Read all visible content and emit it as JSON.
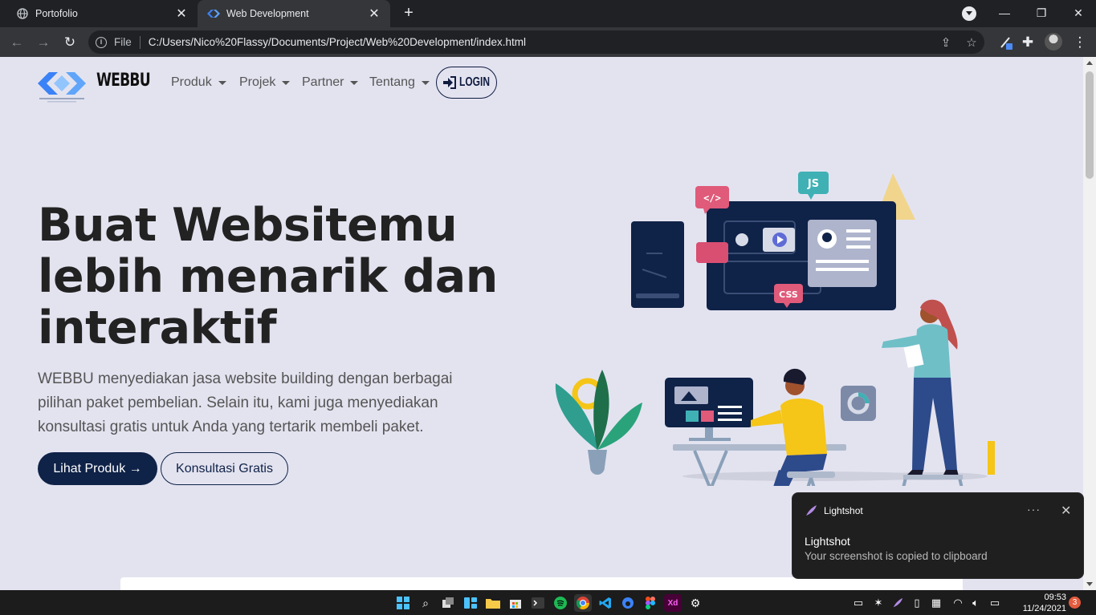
{
  "browser": {
    "tabs": [
      {
        "title": "Portofolio",
        "active": false
      },
      {
        "title": "Web Development",
        "active": true
      }
    ],
    "url_scheme": "File",
    "url": "C:/Users/Nico%20Flassy/Documents/Project/Web%20Development/index.html"
  },
  "site": {
    "brand": "WEBBU",
    "nav": [
      "Produk",
      "Projek",
      "Partner",
      "Tentang"
    ],
    "login_label": "LOGIN",
    "hero": {
      "title_lines": [
        "Buat Websitemu",
        "lebih menarik dan",
        "interaktif"
      ],
      "description": "WEBBU menyediakan jasa website building dengan berbagai pilihan paket pembelian. Selain itu, kami juga menyediakan konsultasi gratis untuk Anda yang tertarik membeli paket.",
      "primary_button": "Lihat Produk →",
      "secondary_button": "Konsultasi Gratis"
    },
    "illustration_labels": {
      "html": "</>",
      "js": "JS",
      "css": "CSS"
    }
  },
  "notification": {
    "app": "Lightshot",
    "title": "Lightshot",
    "message": "Your screenshot is copied to clipboard",
    "more": "···",
    "close": "✕"
  },
  "taskbar": {
    "time": "09:53",
    "date": "11/24/2021",
    "badge": "3"
  },
  "colors": {
    "page_bg": "#e3e3f0",
    "accent": "#0f2247",
    "browser_bg": "#202124"
  }
}
